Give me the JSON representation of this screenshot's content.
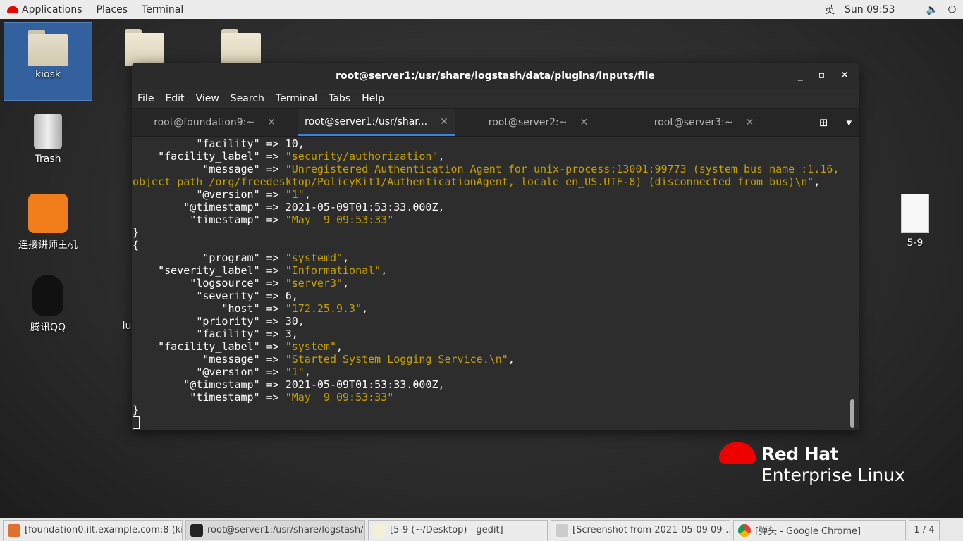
{
  "topbar": {
    "applications": "Applications",
    "places": "Places",
    "terminal": "Terminal",
    "input_method": "英",
    "clock": "Sun 09:53"
  },
  "desktop": {
    "icons": [
      {
        "label": "kiosk"
      },
      {
        "label": "Trash"
      },
      {
        "label": "连接讲师主机"
      },
      {
        "label": "腾讯QQ"
      },
      {
        "label": "lu"
      },
      {
        "label": "5-9"
      }
    ]
  },
  "terminal": {
    "title": "root@server1:/usr/share/logstash/data/plugins/inputs/file",
    "menu": [
      "File",
      "Edit",
      "View",
      "Search",
      "Terminal",
      "Tabs",
      "Help"
    ],
    "tabs": [
      {
        "label": "root@foundation9:~"
      },
      {
        "label": "root@server1:/usr/shar..."
      },
      {
        "label": "root@server2:~"
      },
      {
        "label": "root@server3:~"
      }
    ],
    "active_tab": 1,
    "lines": [
      {
        "k": "facility",
        "v": "10",
        "s": false
      },
      {
        "k": "facility_label",
        "v": "security/authorization",
        "s": true
      },
      {
        "k": "message",
        "v": "Unregistered Authentication Agent for unix-process:13001:99773 (system bus name :1.16, object path /org/freedesktop/PolicyKit1/AuthenticationAgent, locale en_US.UTF-8) (disconnected from bus)\\n",
        "s": true
      },
      {
        "k": "@version",
        "v": "1",
        "s": true
      },
      {
        "k": "@timestamp",
        "v": "2021-05-09T01:53:33.000Z",
        "s": false
      },
      {
        "k": "timestamp",
        "v": "May  9 09:53:33",
        "s": true,
        "last": true
      },
      {
        "b": "}"
      },
      {
        "b": "{"
      },
      {
        "k": "program",
        "v": "systemd",
        "s": true
      },
      {
        "k": "severity_label",
        "v": "Informational",
        "s": true
      },
      {
        "k": "logsource",
        "v": "server3",
        "s": true
      },
      {
        "k": "severity",
        "v": "6",
        "s": false
      },
      {
        "k": "host",
        "v": "172.25.9.3",
        "s": true
      },
      {
        "k": "priority",
        "v": "30",
        "s": false
      },
      {
        "k": "facility",
        "v": "3",
        "s": false
      },
      {
        "k": "facility_label",
        "v": "system",
        "s": true
      },
      {
        "k": "message",
        "v": "Started System Logging Service.\\n",
        "s": true
      },
      {
        "k": "@version",
        "v": "1",
        "s": true
      },
      {
        "k": "@timestamp",
        "v": "2021-05-09T01:53:33.000Z",
        "s": false
      },
      {
        "k": "timestamp",
        "v": "May  9 09:53:33",
        "s": true,
        "last": true
      },
      {
        "b": "}"
      }
    ]
  },
  "taskbar": {
    "items": [
      {
        "label": "[foundation0.ilt.example.com:8 (kio..."
      },
      {
        "label": "root@server1:/usr/share/logstash/..."
      },
      {
        "label": "[5-9 (~/Desktop) - gedit]"
      },
      {
        "label": "[Screenshot from 2021-05-09 09-..."
      },
      {
        "label": "[弹头 - Google Chrome]"
      }
    ],
    "workspace": "1 / 4"
  },
  "branding": {
    "line1": "Red Hat",
    "line2": "Enterprise Linux"
  },
  "colors": {
    "string": "#c4a000",
    "accent": "#3584e4",
    "redhat": "#ee0000"
  }
}
